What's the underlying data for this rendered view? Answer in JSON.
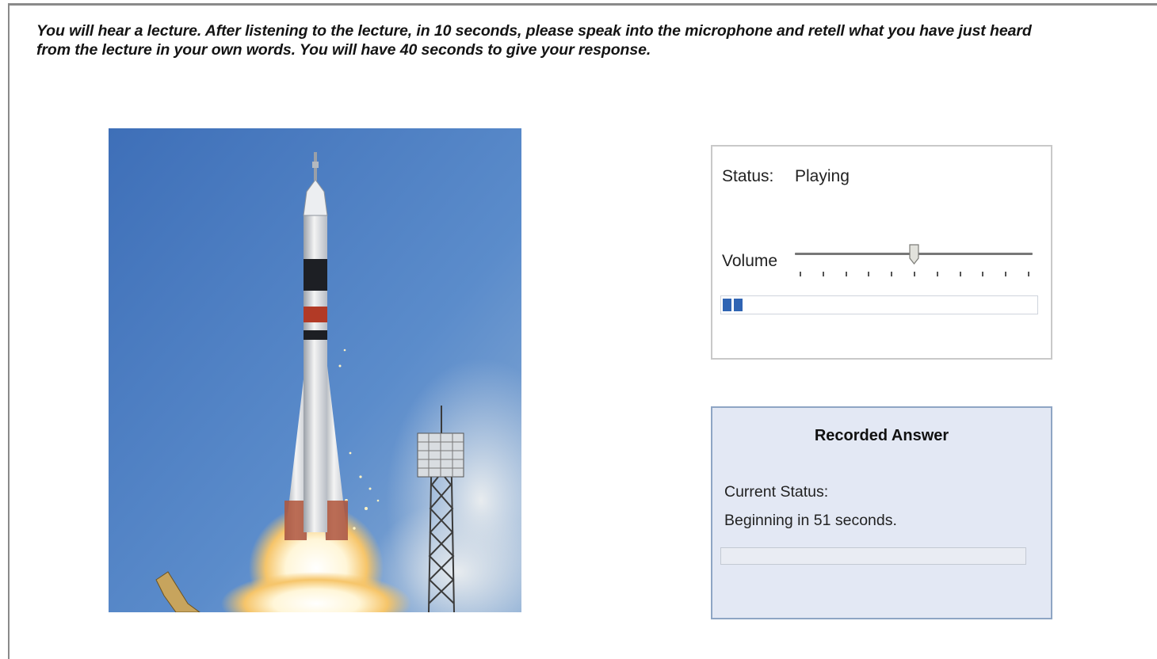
{
  "instructions": {
    "line1": "You will hear a lecture. After listening to the lecture, in 10 seconds, please speak into the microphone and retell what you have just heard",
    "line2": "from the lecture in your own words.  You will have 40 seconds to give your response."
  },
  "player": {
    "status_label": "Status:",
    "status_value": "Playing",
    "volume_label": "Volume",
    "volume_level": 0.5,
    "volume_ticks": 11,
    "playback_progress": 0.07
  },
  "recorder": {
    "title": "Recorded Answer",
    "status_label": "Current Status:",
    "status_value": "Beginning in 51 seconds.",
    "recording_progress": 0
  },
  "colors": {
    "progress_fill": "#2f64b3",
    "recorder_bg": "#e3e8f4",
    "recorder_border": "#8ea5c4",
    "sky": "#4f7fc2"
  }
}
